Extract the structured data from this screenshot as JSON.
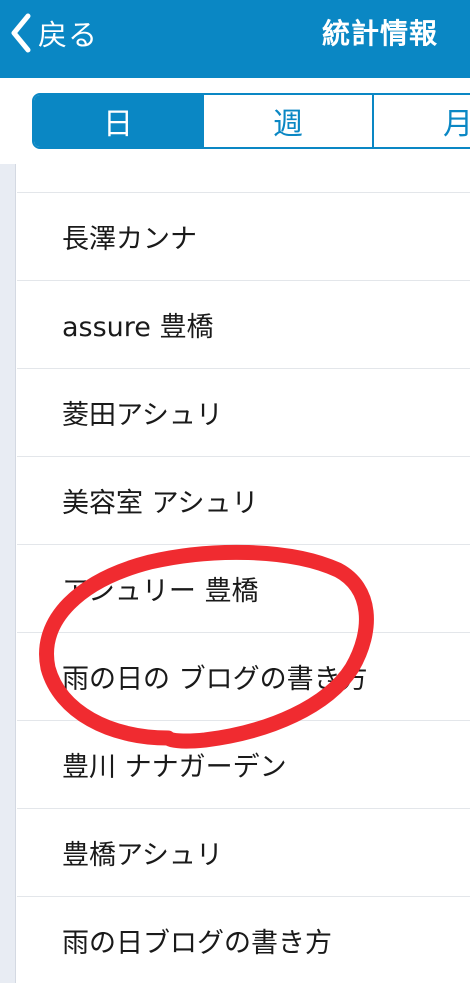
{
  "navbar": {
    "back_label": "戻る",
    "title": "統計情報"
  },
  "segments": [
    {
      "label": "日",
      "selected": true
    },
    {
      "label": "週",
      "selected": false
    },
    {
      "label": "月",
      "selected": false
    }
  ],
  "list": {
    "items": [
      "",
      "長澤カンナ",
      "assure 豊橋",
      "菱田アシュリ",
      "美容室 アシュリ",
      "アシュリー 豊橋",
      "雨の日の ブログの書き方",
      "豊川 ナナガーデン",
      "豊橋アシュリ",
      "雨の日ブログの書き方"
    ]
  },
  "colors": {
    "accent": "#0a87c4",
    "annotation": "#f02b30"
  },
  "icons": {
    "back": "chevron-left-icon"
  }
}
